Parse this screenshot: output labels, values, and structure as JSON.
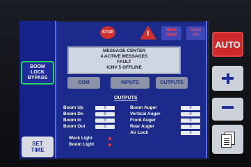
{
  "left_panel": {
    "boom_lock_bypass": "BOOM\nLOCK\nBYPASS",
    "set_time": "SET\nTIME"
  },
  "status": {
    "stop": "STOP",
    "high_temp": "HIGH\nTEMP",
    "high_psi": "HIGH\nPSI"
  },
  "message_center": {
    "title": "MESSAGE CENTER",
    "count": "4  ACTIVE MESSAGES",
    "line1": "FAULT",
    "line2": "ICNV 5 OFFLINE"
  },
  "tabs": {
    "com": "COM",
    "inputs": "INPUTS",
    "outputs": "OUTPUTS"
  },
  "outputs": {
    "title": "OUTPUTS",
    "left": [
      {
        "label": "Boom Up",
        "value": "0"
      },
      {
        "label": "Boom Dn",
        "value": "0"
      },
      {
        "label": "Boom In",
        "value": "0"
      },
      {
        "label": "Boom Out",
        "value": "0"
      }
    ],
    "right": [
      {
        "label": "Boom Auger",
        "value": "0"
      },
      {
        "label": "Vertical Auger",
        "value": "0"
      },
      {
        "label": "Front Auger",
        "value": "0"
      },
      {
        "label": "Rear Auger",
        "value": "0"
      },
      {
        "label": "Air Lock",
        "value": "0"
      }
    ],
    "lights": [
      {
        "label": "Work Light"
      },
      {
        "label": "Boom Light"
      }
    ]
  },
  "right_panel": {
    "auto": "AUTO"
  },
  "colors": {
    "screen_bg": "#1c2a8c",
    "accent_red": "#cc2a2a",
    "accent_green": "#25d55a"
  }
}
